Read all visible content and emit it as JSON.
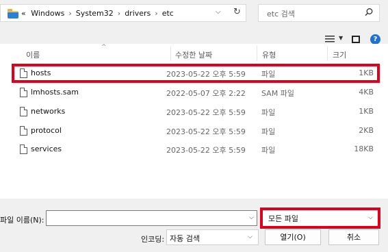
{
  "address_bar": {
    "overflow": "«",
    "crumbs": [
      "Windows",
      "System32",
      "drivers",
      "etc"
    ],
    "separator": "›",
    "dropdown_glyph": "⌵",
    "refresh_glyph": "↻"
  },
  "search": {
    "placeholder": "etc 검색",
    "icon": "search-icon"
  },
  "toolbar": {
    "view_glyph": "≡",
    "view_dd": "▼",
    "help": "?"
  },
  "columns": {
    "name": "이름",
    "date": "수정한 날짜",
    "type": "유형",
    "size": "크기",
    "sort_glyph": "^"
  },
  "files": [
    {
      "name": "hosts",
      "date": "2023-05-22 오후 5:59",
      "type": "파일",
      "size": "1KB"
    },
    {
      "name": "lmhosts.sam",
      "date": "2022-05-07 오후 2:22",
      "type": "SAM 파일",
      "size": "4KB"
    },
    {
      "name": "networks",
      "date": "2023-05-22 오후 5:59",
      "type": "파일",
      "size": "1KB"
    },
    {
      "name": "protocol",
      "date": "2023-05-22 오후 5:59",
      "type": "파일",
      "size": "2KB"
    },
    {
      "name": "services",
      "date": "2023-05-22 오후 5:59",
      "type": "파일",
      "size": "18KB"
    }
  ],
  "bottom": {
    "filename_label": "파일 이름(N):",
    "filename_value": "",
    "filter_value": "모든 파일",
    "encoding_label": "인코딩:",
    "encoding_value": "자동 검색",
    "open_label": "열기(O)",
    "cancel_label": "취소",
    "chevron": "⌵"
  },
  "colors": {
    "highlight": "#e1001b",
    "help_blue": "#1e73d2"
  }
}
